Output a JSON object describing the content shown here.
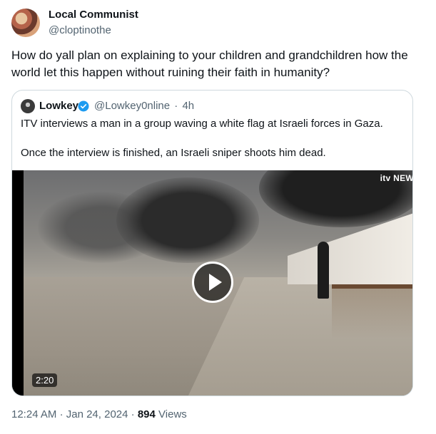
{
  "author": {
    "name": "Local Communist",
    "handle": "@cloptinothe"
  },
  "tweet_text": "How do yall plan on explaining to your children and grandchildren how the world let this happen without ruining their faith in humanity?",
  "quoted": {
    "name": "Lowkey",
    "verified_icon": "verified-badge-icon",
    "handle": "@Lowkey0nline",
    "separator": "·",
    "time_ago": "4h",
    "text_line1": "ITV interviews a man in a group waving a white flag at Israeli forces in Gaza.",
    "text_line2": "Once the interview is finished, an Israeli sniper shoots him dead.",
    "video": {
      "watermark": "itv NEW",
      "duration": "2:20",
      "play_icon": "play-icon"
    }
  },
  "footer": {
    "time": "12:24 AM",
    "separator": "·",
    "date": "Jan 24, 2024",
    "separator2": "·",
    "views_count": "894",
    "views_label": "Views"
  },
  "colors": {
    "text_primary": "#0f1419",
    "text_secondary": "#536471",
    "border": "#cfd9de",
    "verified": "#1d9bf0"
  }
}
